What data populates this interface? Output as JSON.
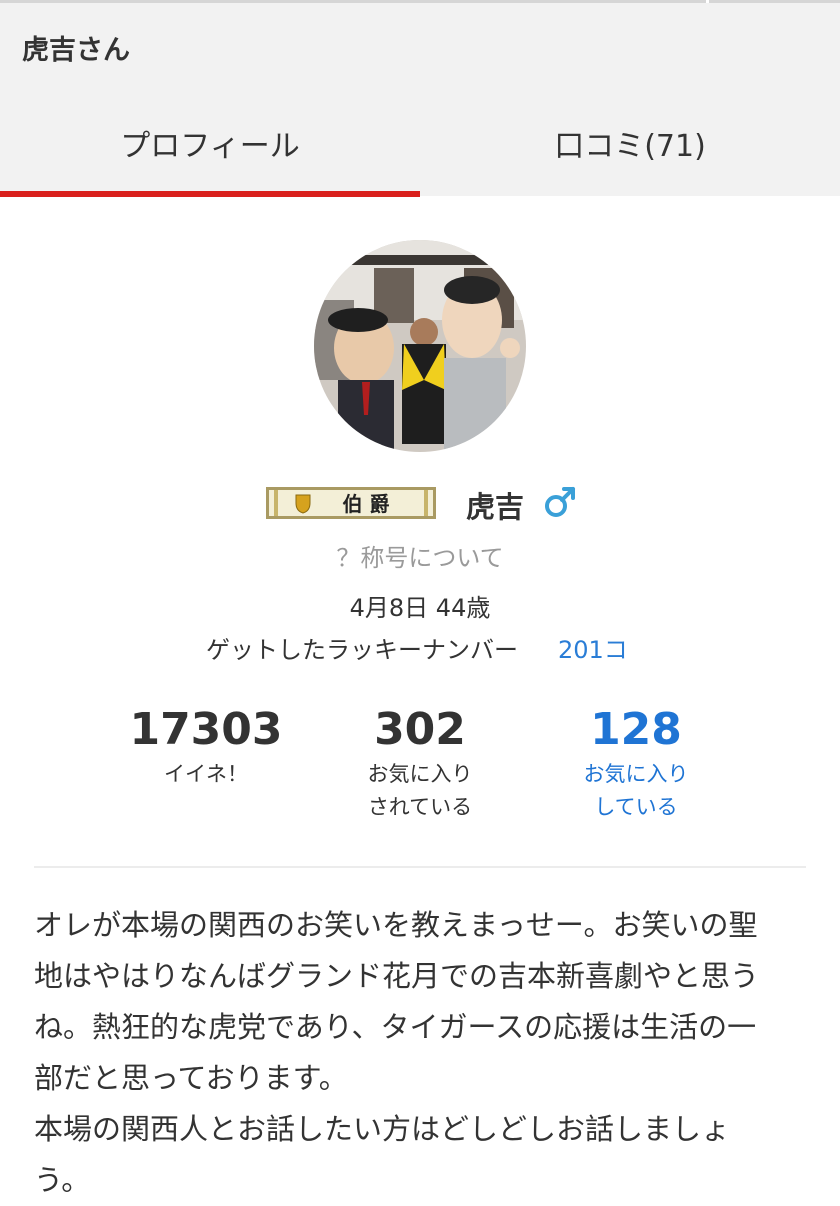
{
  "header": {
    "title": "虎吉さん",
    "tabs": [
      {
        "label": "プロフィール",
        "active": true
      },
      {
        "label": "口コミ(71)",
        "active": false
      }
    ]
  },
  "colors": {
    "accent_red": "#d9201c",
    "link_blue": "#2a7dd6",
    "male_icon": "#3aa0d8"
  },
  "profile": {
    "rank_label": "伯 爵",
    "name": "虎吉",
    "gender_icon": "male-icon",
    "title_link": "？称号について",
    "birthday_age": "4月8日 44歳",
    "lucky_label": "ゲットしたラッキーナンバー",
    "lucky_value": "201コ"
  },
  "stats": [
    {
      "value": "17303",
      "label_lines": [
        "イイネ！"
      ]
    },
    {
      "value": "302",
      "label_lines": [
        "お気に入り",
        "されている"
      ]
    },
    {
      "value": "128",
      "label_lines": [
        "お気に入り",
        "している"
      ]
    }
  ],
  "bio": "オレが本場の関西のお笑いを教えまっせー。お笑いの聖\n地はやはりなんばグランド花月での吉本新喜劇やと思う\nね。熱狂的な虎党であり、タイガースの応援は生活の一\n部だと思っております。\n本場の関西人とお話したい方はどしどしお話しましょ\nう。"
}
